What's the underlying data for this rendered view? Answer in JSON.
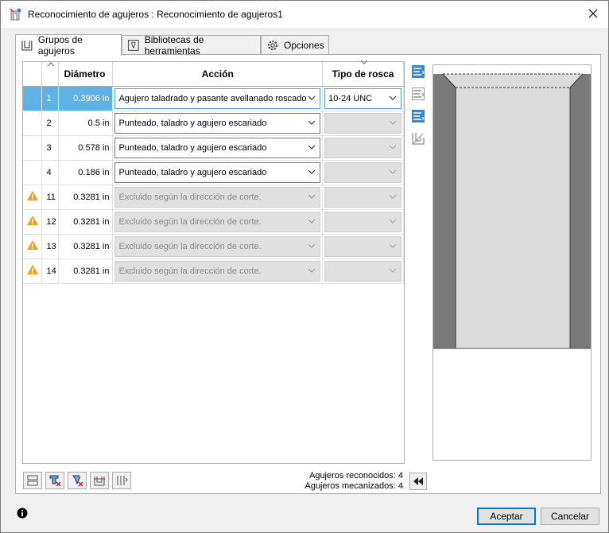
{
  "window": {
    "title": "Reconocimiento de agujeros : Reconocimiento de agujeros1"
  },
  "tabs": [
    {
      "label": "Grupos de agujeros",
      "icon": "hole-group-icon"
    },
    {
      "label": "Bibliotecas de herramientas",
      "icon": "tool-library-icon"
    },
    {
      "label": "Opciones",
      "icon": "gear-icon"
    }
  ],
  "table": {
    "headers": {
      "diameter": "Diámetro",
      "action": "Acción",
      "thread": "Tipo de rosca"
    },
    "rows": [
      {
        "warn": false,
        "id": "1",
        "diameter": "0.3906 in",
        "action": "Agujero taladrado y pasante avellanado roscado",
        "thread": "10-24 UNC",
        "disabled": false
      },
      {
        "warn": false,
        "id": "2",
        "diameter": "0.5 in",
        "action": "Punteado, taladro y agujero escariado",
        "thread": "",
        "disabled": false
      },
      {
        "warn": false,
        "id": "3",
        "diameter": "0.578 in",
        "action": "Punteado, taladro y agujero escariado",
        "thread": "",
        "disabled": false
      },
      {
        "warn": false,
        "id": "4",
        "diameter": "0.186 in",
        "action": "Punteado, taladro y agujero escariado",
        "thread": "",
        "disabled": false
      },
      {
        "warn": true,
        "id": "11",
        "diameter": "0.3281 in",
        "action": "Excluido según la dirección de corte.",
        "thread": "",
        "disabled": true
      },
      {
        "warn": true,
        "id": "12",
        "diameter": "0.3281 in",
        "action": "Excluido según la dirección de corte.",
        "thread": "",
        "disabled": true
      },
      {
        "warn": true,
        "id": "13",
        "diameter": "0.3281 in",
        "action": "Excluido según la dirección de corte.",
        "thread": "",
        "disabled": true
      },
      {
        "warn": true,
        "id": "14",
        "diameter": "0.3281 in",
        "action": "Excluido según la dirección de corte.",
        "thread": "",
        "disabled": true
      }
    ]
  },
  "stats": {
    "recognized": "Agujeros reconocidos: 4",
    "machined": "Agujeros mecanizados: 4"
  },
  "buttons": {
    "ok": "Aceptar",
    "cancel": "Cancelar"
  },
  "colors": {
    "selection": "#5fb2e5",
    "warning": "#f0a020",
    "accent": "#0078d7"
  }
}
